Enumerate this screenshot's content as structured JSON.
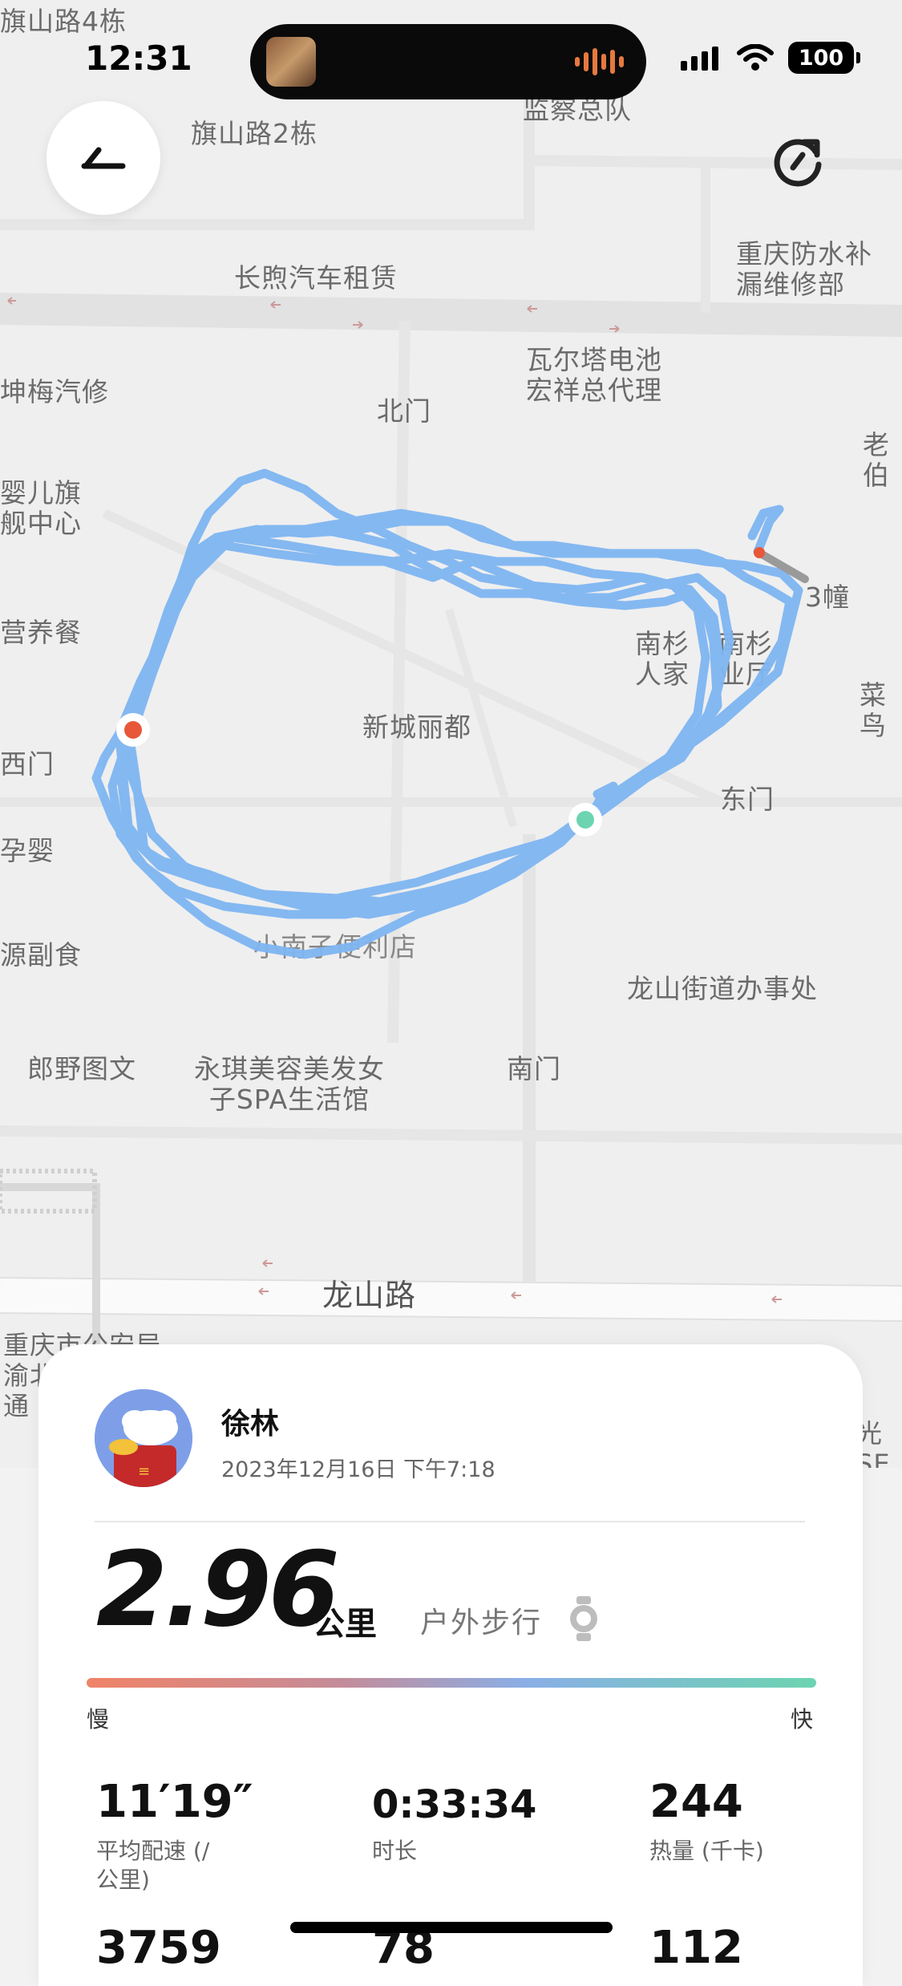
{
  "status_bar": {
    "time": "12:31",
    "battery": "100"
  },
  "map": {
    "pois": [
      "旗山路4栋",
      "旗山路2栋",
      "监察总队",
      "长煦汽车租赁",
      "重庆防水补\n漏维修部",
      "瓦尔塔电池\n宏祥总代理",
      "北门",
      "坤梅汽修",
      "老伯",
      "婴儿旗\n舰中心",
      "营养餐",
      "南杉\n人家",
      "南杉\n业厅",
      "3幢",
      "菜鸟",
      "新城丽都",
      "西门",
      "东门",
      "孕婴",
      "源副食",
      "龙山街道办事处",
      "小南子便利店",
      "郎野图文",
      "永琪美容美发女\n子SPA生活馆",
      "南门",
      "龙山路",
      "重庆市公安局\n渝北\n通",
      "光SE"
    ],
    "route_color": "#7fb6f2",
    "start_color": "#6cd4b0",
    "end_color": "#e8573a"
  },
  "record": {
    "user_name": "徐林",
    "datetime": "2023年12月16日  下午7:18",
    "distance": "2.96",
    "unit": "公里",
    "activity": "户外步行",
    "pace_slow": "慢",
    "pace_fast": "快",
    "stats": [
      {
        "value": "11′19″",
        "label": "平均配速 (/\n公里)"
      },
      {
        "value": "0:33:34",
        "label": "时长"
      },
      {
        "value": "244",
        "label": "热量 (千卡)"
      },
      {
        "value": "3759",
        "label": ""
      },
      {
        "value": "78",
        "label": ""
      },
      {
        "value": "112",
        "label": ""
      }
    ]
  }
}
